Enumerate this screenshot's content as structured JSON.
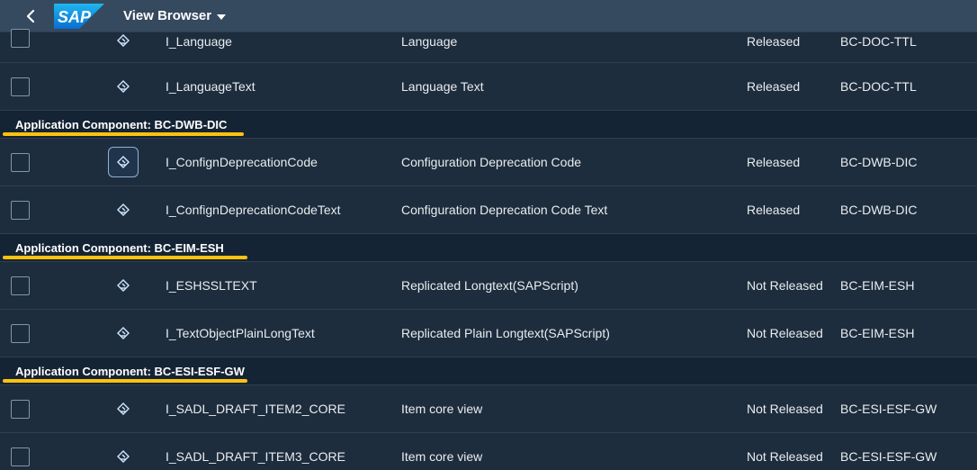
{
  "shell": {
    "app_title": "View Browser",
    "logo_text": "SAP",
    "icons": {
      "back": "chevron-left-icon",
      "title_menu": "caret-down-icon"
    }
  },
  "colors": {
    "shell_bg": "#354a5f",
    "list_bg": "#1d2d3e",
    "group_bg": "#152435",
    "highlight": "#ffc20e"
  },
  "rows_top": [
    {
      "name": "I_Language",
      "description": "Language",
      "release": "Released",
      "component": "BC-DOC-TTL"
    },
    {
      "name": "I_LanguageText",
      "description": "Language Text",
      "release": "Released",
      "component": "BC-DOC-TTL"
    }
  ],
  "groups": [
    {
      "label": "Application Component: BC-DWB-DIC",
      "rows": [
        {
          "name": "I_ConfignDeprecationCode",
          "description": "Configuration Deprecation Code",
          "release": "Released",
          "component": "BC-DWB-DIC"
        },
        {
          "name": "I_ConfignDeprecationCodeText",
          "description": "Configuration Deprecation Code Text",
          "release": "Released",
          "component": "BC-DWB-DIC"
        }
      ]
    },
    {
      "label": "Application Component: BC-EIM-ESH",
      "rows": [
        {
          "name": "I_ESHSSLTEXT",
          "description": "Replicated Longtext(SAPScript)",
          "release": "Not Released",
          "component": "BC-EIM-ESH"
        },
        {
          "name": "I_TextObjectPlainLongText",
          "description": "Replicated Plain Longtext(SAPScript)",
          "release": "Not Released",
          "component": "BC-EIM-ESH"
        }
      ]
    },
    {
      "label": "Application Component: BC-ESI-ESF-GW",
      "rows": [
        {
          "name": "I_SADL_DRAFT_ITEM2_CORE",
          "description": "Item core view",
          "release": "Not Released",
          "component": "BC-ESI-ESF-GW"
        },
        {
          "name": "I_SADL_DRAFT_ITEM3_CORE",
          "description": "Item core view",
          "release": "Not Released",
          "component": "BC-ESI-ESF-GW"
        }
      ]
    }
  ]
}
